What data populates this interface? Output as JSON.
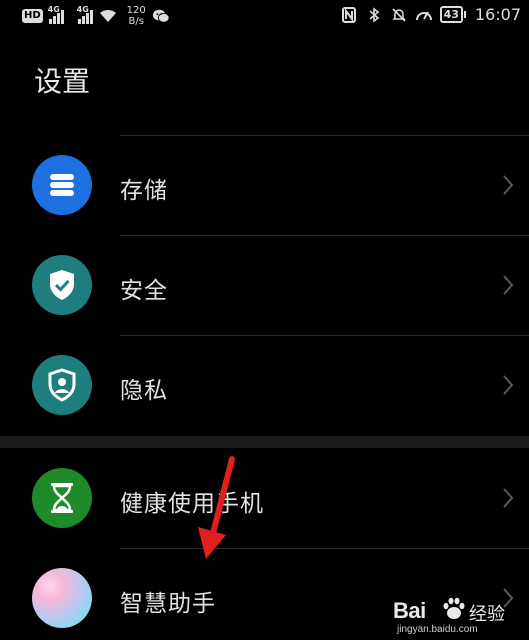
{
  "status_bar": {
    "hd_label": "HD",
    "network_1": "4G",
    "network_2": "4G",
    "speed_value": "120",
    "speed_unit": "B/s",
    "battery": "43",
    "time": "16:07",
    "icons": [
      "wifi-icon",
      "wechat-icon",
      "nfc-icon",
      "bluetooth-icon",
      "mute-icon",
      "speedometer-icon"
    ]
  },
  "title": "设置",
  "settings_group_1": [
    {
      "label": "存储",
      "icon": "storage-icon",
      "color": "#1e6fe0"
    },
    {
      "label": "安全",
      "icon": "shield-check-icon",
      "color": "#1e7d7d"
    },
    {
      "label": "隐私",
      "icon": "privacy-icon",
      "color": "#1e7d7d"
    }
  ],
  "settings_group_2": [
    {
      "label": "健康使用手机",
      "icon": "hourglass-icon",
      "color": "#1e8a2a"
    },
    {
      "label": "智慧助手",
      "icon": "assistant-icon",
      "color": "gradient"
    }
  ],
  "annotation": {
    "color": "#e0201e"
  },
  "watermark": {
    "brand": "Bai",
    "suffix": "经验",
    "url": "jingyan.baidu.com"
  }
}
